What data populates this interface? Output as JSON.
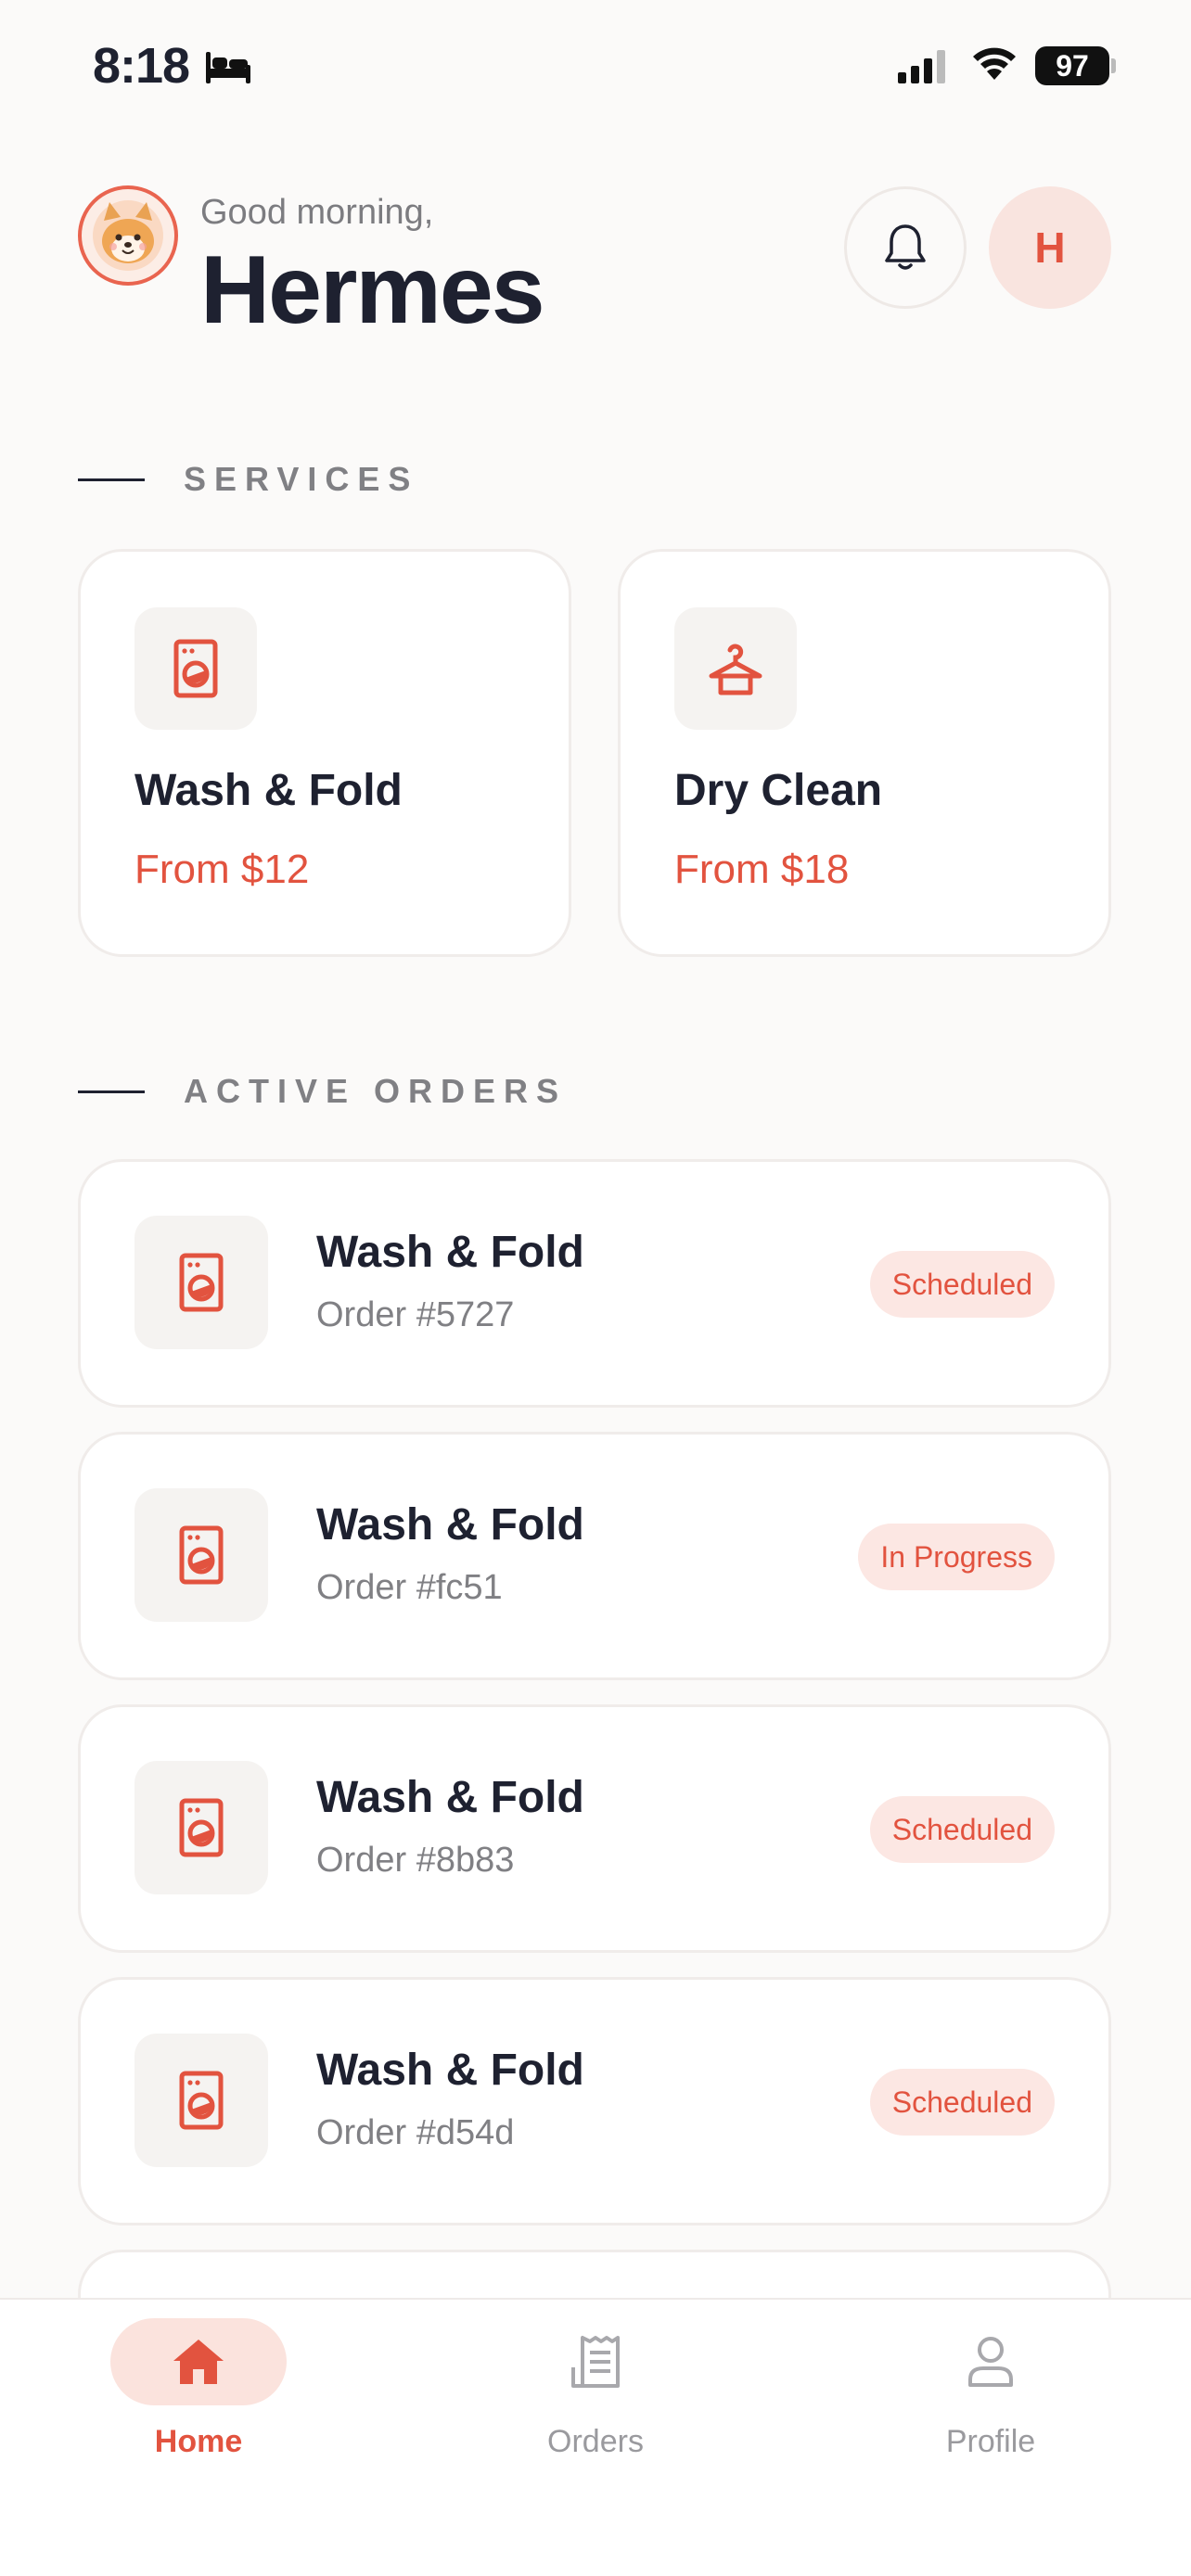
{
  "status_bar": {
    "time": "8:18",
    "battery": "97"
  },
  "header": {
    "greeting": "Good morning,",
    "name": "Hermes",
    "profile_initial": "H"
  },
  "services": {
    "title": "SERVICES",
    "items": [
      {
        "name": "Wash & Fold",
        "price": "From $12",
        "icon": "washing-machine-icon"
      },
      {
        "name": "Dry Clean",
        "price": "From $18",
        "icon": "hanger-icon"
      }
    ]
  },
  "active_orders": {
    "title": "ACTIVE ORDERS",
    "items": [
      {
        "service": "Wash & Fold",
        "order": "Order #5727",
        "status": "Scheduled"
      },
      {
        "service": "Wash & Fold",
        "order": "Order #fc51",
        "status": "In Progress"
      },
      {
        "service": "Wash & Fold",
        "order": "Order #8b83",
        "status": "Scheduled"
      },
      {
        "service": "Wash & Fold",
        "order": "Order #d54d",
        "status": "Scheduled"
      }
    ]
  },
  "nav": {
    "items": [
      {
        "label": "Home",
        "icon": "home-icon",
        "active": true
      },
      {
        "label": "Orders",
        "icon": "receipt-icon",
        "active": false
      },
      {
        "label": "Profile",
        "icon": "person-icon",
        "active": false
      }
    ]
  },
  "colors": {
    "accent": "#E2533F",
    "accent_soft": "#FCE7E3",
    "background": "#FBFAF9",
    "text": "#1E2130",
    "muted": "#808084"
  }
}
